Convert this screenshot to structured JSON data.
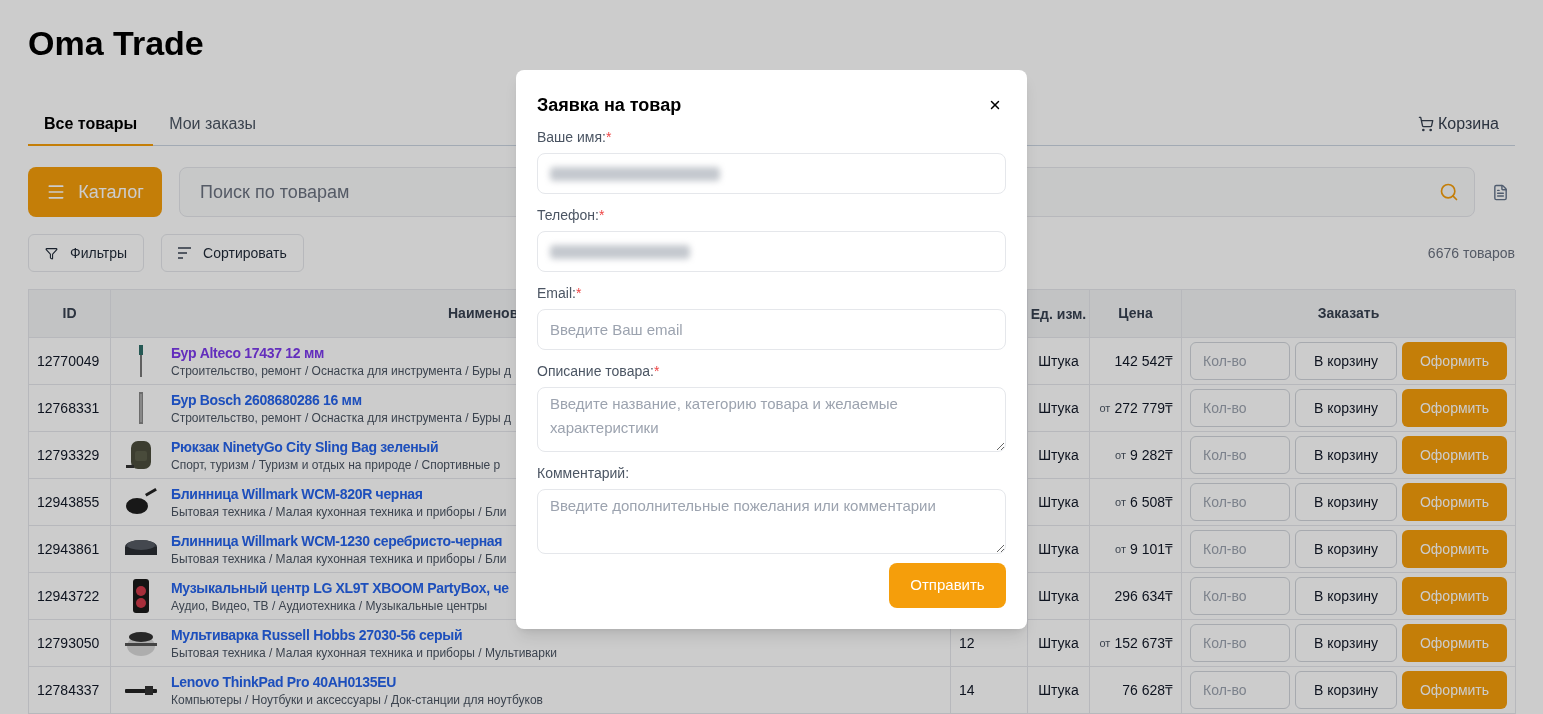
{
  "app_title": "Oma Trade",
  "tabs": [
    {
      "label": "Все товары",
      "selected": true
    },
    {
      "label": "Мои заказы",
      "selected": false
    }
  ],
  "cart_link": {
    "label": "Корзина"
  },
  "catalog_button": {
    "label": "Каталог"
  },
  "search": {
    "placeholder": "Поиск по товарам"
  },
  "toolbar": {
    "filters": "Фильтры",
    "sort": "Сортировать",
    "count": "6676 товаров"
  },
  "table": {
    "columns": {
      "id": "ID",
      "name": "Наименов",
      "unit": "Ед. изм.",
      "price": "Цена",
      "order": "Заказать"
    },
    "rows": [
      {
        "id": "12770049",
        "name": "Бур Alteco 17437 12 мм",
        "visited": true,
        "category": "Строительство, ремонт / Оснастка для инструмента / Буры д",
        "unit": "Штука",
        "price": "142 542₸",
        "quantity_placeholder": "Кол-во",
        "cart_button": "В корзину",
        "order_button": "Оформить"
      },
      {
        "id": "12768331",
        "name": "Бур Bosch 2608680286 16 мм",
        "visited": false,
        "category": "Строительство, ремонт / Оснастка для инструмента / Буры д",
        "unit": "Штука",
        "price_prefix": "от",
        "price": "272 779₸",
        "quantity_placeholder": "Кол-во",
        "cart_button": "В корзину",
        "order_button": "Оформить"
      },
      {
        "id": "12793329",
        "name": "Рюкзак NinetyGo City Sling Bag зеленый",
        "visited": false,
        "category": "Спорт, туризм / Туризм и отдых на природе / Спортивные р",
        "unit": "Штука",
        "price_prefix": "от",
        "price": "9 282₸",
        "quantity_placeholder": "Кол-во",
        "cart_button": "В корзину",
        "order_button": "Оформить"
      },
      {
        "id": "12943855",
        "name": "Блинница Willmark WCM-820R черная",
        "visited": false,
        "category": "Бытовая техника / Малая кухонная техника и приборы / Бли",
        "unit": "Штука",
        "price_prefix": "от",
        "price": "6 508₸",
        "quantity_placeholder": "Кол-во",
        "cart_button": "В корзину",
        "order_button": "Оформить"
      },
      {
        "id": "12943861",
        "name": "Блинница Willmark WCM-1230 серебристо-черная",
        "visited": false,
        "category": "Бытовая техника / Малая кухонная техника и приборы / Бли",
        "unit": "Штука",
        "price_prefix": "от",
        "price": "9 101₸",
        "quantity_placeholder": "Кол-во",
        "cart_button": "В корзину",
        "order_button": "Оформить"
      },
      {
        "id": "12943722",
        "name": "Музыкальный центр LG XL9T XBOOM PartyBox, че",
        "visited": false,
        "category": "Аудио, Видео, ТВ / Аудиотехника / Музыкальные центры",
        "unit": "Штука",
        "price": "296 634₸",
        "quantity_placeholder": "Кол-во",
        "cart_button": "В корзину",
        "order_button": "Оформить"
      },
      {
        "id": "12793050",
        "name": "Мультиварка Russell Hobbs 27030-56 серый",
        "visited": false,
        "category": "Бытовая техника / Малая кухонная техника и приборы / Мультиварки",
        "column_3": "12",
        "unit": "Штука",
        "price_prefix": "от",
        "price": "152 673₸",
        "quantity_placeholder": "Кол-во",
        "cart_button": "В корзину",
        "order_button": "Оформить"
      },
      {
        "id": "12784337",
        "name": "Lenovo ThinkPad Pro 40AH0135EU",
        "visited": false,
        "category": "Компьютеры / Ноутбуки и аксессуары / Док-станции для ноутбуков",
        "column_3": "14",
        "unit": "Штука",
        "price": "76 628₸",
        "quantity_placeholder": "Кол-во",
        "cart_button": "В корзину",
        "order_button": "Оформить"
      }
    ]
  },
  "dialog": {
    "title": "Заявка на товар",
    "fields": [
      {
        "kind": "input",
        "label": "Ваше имя:",
        "required_mark": "*",
        "value_redacted": true
      },
      {
        "kind": "input",
        "label": "Телефон:",
        "required_mark": "*",
        "value_redacted": true
      },
      {
        "kind": "input",
        "label": "Email:",
        "required_mark": "*",
        "placeholder": "Введите Ваш email"
      },
      {
        "kind": "textarea",
        "label": "Описание товара:",
        "required_mark": "*",
        "placeholder": "Введите название, категорию товара и желаемые характеристики"
      },
      {
        "kind": "textarea",
        "label": "Комментарий:",
        "placeholder": "Введите дополнительные пожелания или комментарии"
      }
    ],
    "submit": "Отправить"
  }
}
